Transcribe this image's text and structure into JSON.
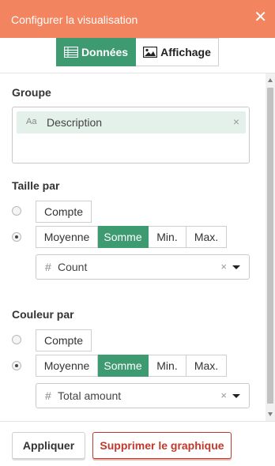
{
  "header": {
    "title": "Configurer la visualisation",
    "close_icon": "close-icon",
    "background": "#f2845f"
  },
  "tabs": [
    {
      "label": "Données",
      "icon": "table-icon",
      "active": true
    },
    {
      "label": "Affichage",
      "icon": "image-icon",
      "active": false
    }
  ],
  "group": {
    "label": "Groupe",
    "chip": {
      "type_icon": "Aa",
      "label": "Description",
      "remove": "×"
    }
  },
  "size_by": {
    "label": "Taille par",
    "count_option": "Compte",
    "aggregations": [
      "Moyenne",
      "Somme",
      "Min.",
      "Max."
    ],
    "selected_aggregation": "Somme",
    "selected_radio": "aggregation",
    "field": {
      "hash": "#",
      "value": "Count",
      "clear": "×"
    }
  },
  "color_by": {
    "label": "Couleur par",
    "count_option": "Compte",
    "aggregations": [
      "Moyenne",
      "Somme",
      "Min.",
      "Max."
    ],
    "selected_aggregation": "Somme",
    "selected_radio": "aggregation",
    "field": {
      "hash": "#",
      "value": "Total amount",
      "clear": "×"
    }
  },
  "footer": {
    "apply": "Appliquer",
    "delete": "Supprimer le graphique"
  },
  "colors": {
    "accent": "#3e9b71",
    "danger": "#c0392b",
    "chip_bg": "#e4f0ea"
  }
}
